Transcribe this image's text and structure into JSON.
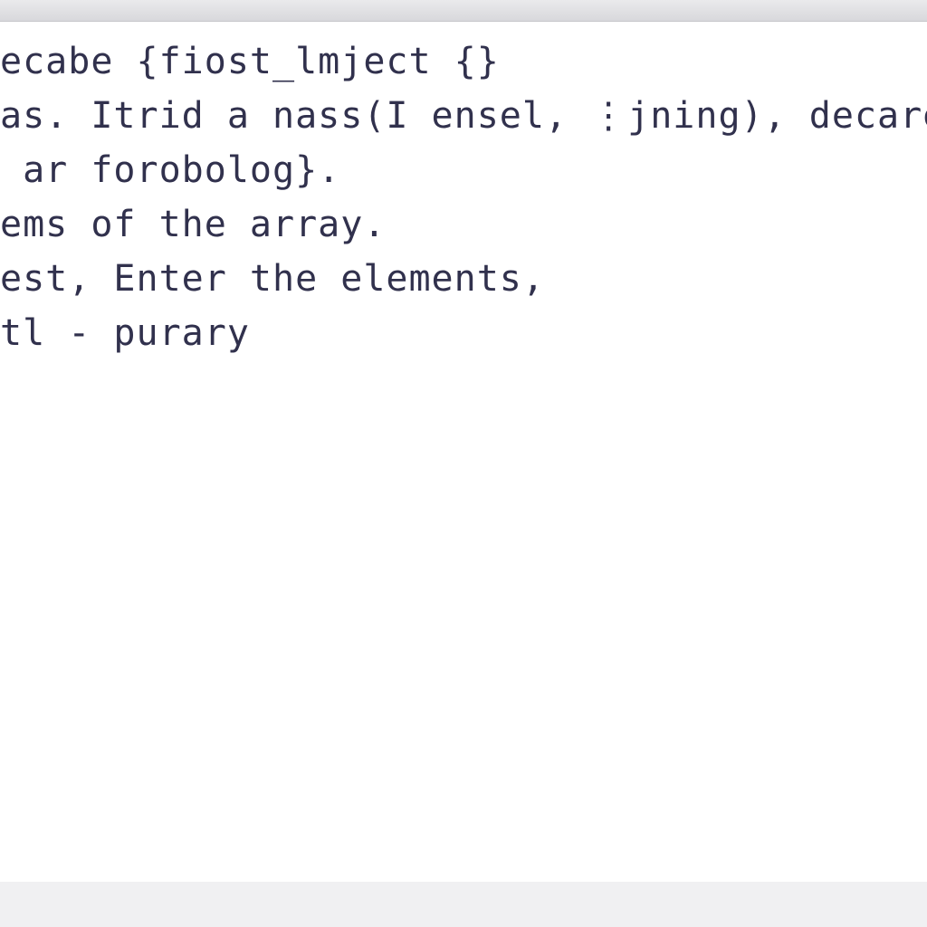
{
  "editor": {
    "lines": [
      "ecabe {fiost_lmject {}",
      "as. Itrid a nass(I ensel, ⋮jning), decare o",
      " ar forobolog}.",
      "",
      "",
      "ems of the array.",
      "est, Enter the elements,",
      "tl - purary"
    ]
  }
}
